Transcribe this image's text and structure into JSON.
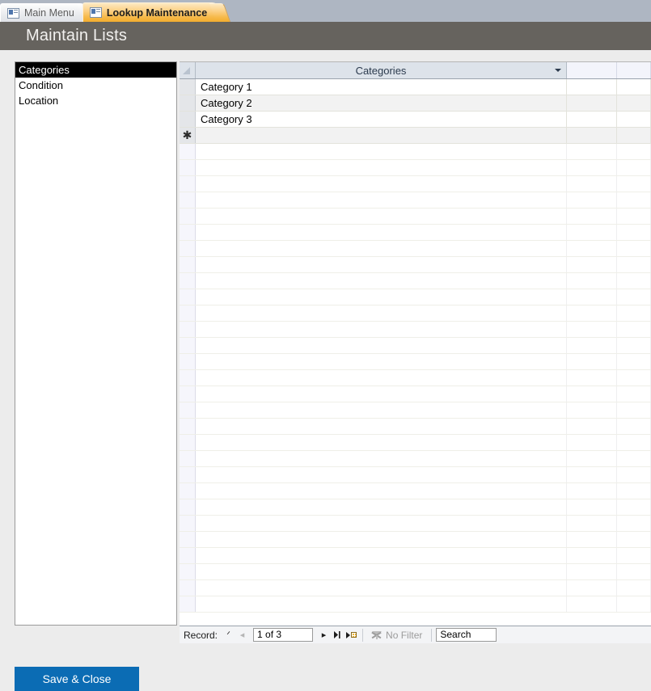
{
  "tabs": [
    {
      "label": "Main Menu",
      "icon": "form-icon",
      "active": false
    },
    {
      "label": "Lookup Maintenance",
      "icon": "form-icon",
      "active": true
    }
  ],
  "header": {
    "title": "Maintain Lists"
  },
  "list_box": {
    "name": "lookup-type-list",
    "items": [
      {
        "label": "Categories",
        "selected": true
      },
      {
        "label": "Condition",
        "selected": false
      },
      {
        "label": "Location",
        "selected": false
      }
    ]
  },
  "datasheet": {
    "columns": [
      "Categories"
    ],
    "rows": [
      {
        "value": "Category 1"
      },
      {
        "value": "Category 2"
      },
      {
        "value": "Category 3"
      }
    ],
    "new_record_marker": "✱",
    "dropdown_icon": "chevron-down-icon",
    "select_all_icon": "select-all-corner-icon"
  },
  "navigator": {
    "label": "Record:",
    "first_icon": "ᐟ",
    "prev_icon": "◂",
    "position": "1 of 3",
    "next_icon": "▸",
    "last_icon": "‖",
    "new_icon": "new-record-icon",
    "filter_label": "No Filter",
    "filter_icon": "filter-icon",
    "search_value": "Search"
  },
  "footer": {
    "save_close_label": "Save & Close",
    "accent_color": "#0b6cb4"
  },
  "colors": {
    "title_bar": "#66635e",
    "tab_strip": "#aeb6c2",
    "active_tab": "#f6b949",
    "header_cell": "#dde3ea",
    "selected_list_item": "#000000"
  }
}
